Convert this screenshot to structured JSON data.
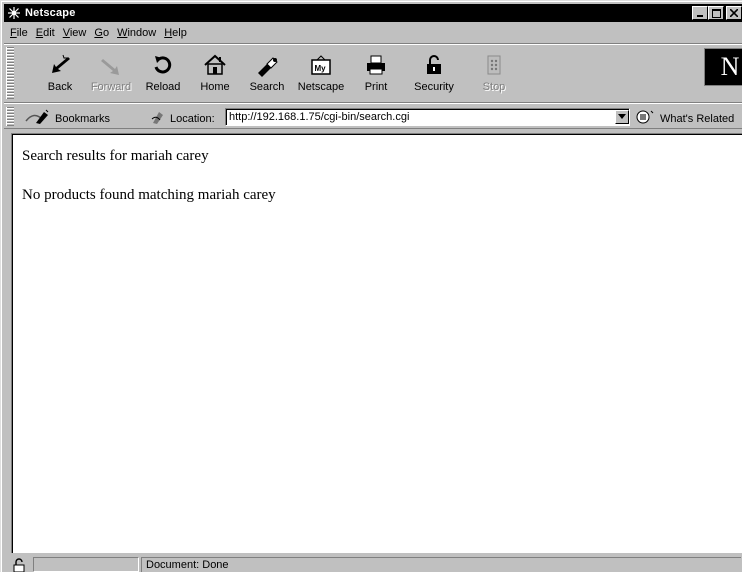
{
  "window": {
    "title": "Netscape"
  },
  "menu": [
    {
      "label": "File",
      "mnemonic": "F"
    },
    {
      "label": "Edit",
      "mnemonic": "E"
    },
    {
      "label": "View",
      "mnemonic": "V"
    },
    {
      "label": "Go",
      "mnemonic": "G"
    },
    {
      "label": "Window",
      "mnemonic": "W"
    },
    {
      "label": "Help",
      "mnemonic": "H"
    }
  ],
  "toolbar": {
    "back": "Back",
    "forward": "Forward",
    "reload": "Reload",
    "home": "Home",
    "search": "Search",
    "netscape": "Netscape",
    "print": "Print",
    "security": "Security",
    "stop": "Stop"
  },
  "logo": "N",
  "location_bar": {
    "bookmarks": "Bookmarks",
    "location_label": "Location:",
    "url": "http://192.168.1.75/cgi-bin/search.cgi",
    "whats_related": "What's Related"
  },
  "content": {
    "heading": "Search results for mariah carey",
    "message": "No products found matching mariah carey"
  },
  "status": {
    "text": "Document: Done"
  }
}
